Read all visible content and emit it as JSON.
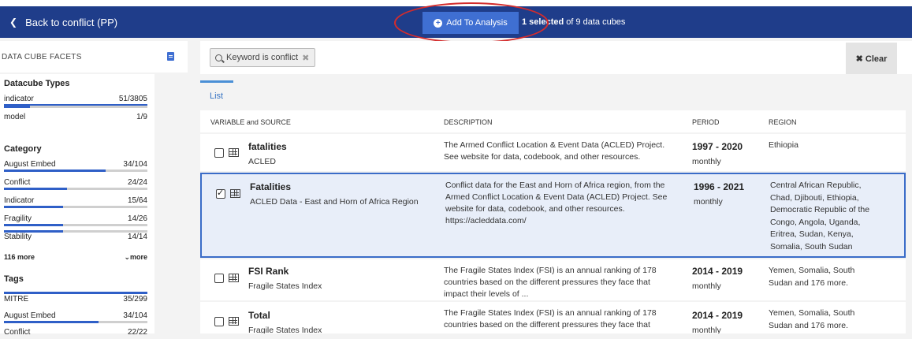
{
  "header": {
    "back_label": "Back to conflict (PP)",
    "add_button_label": "Add To Analysis",
    "selected_count": "1 selected",
    "selected_suffix": "of 9 data cubes"
  },
  "sidebar": {
    "title": "DATA CUBE FACETS",
    "groups": [
      {
        "title": "Datacube Types",
        "items": [
          {
            "label": "indicator",
            "count": "51/3805",
            "fraction": 1.0
          },
          {
            "label": "model",
            "count": "1/9",
            "fraction": 0.18
          }
        ]
      },
      {
        "title": "Category",
        "items": [
          {
            "label": "August Embed",
            "count": "34/104",
            "fraction": 0.71
          },
          {
            "label": "Conflict",
            "count": "24/24",
            "fraction": 0.44
          },
          {
            "label": "Indicator",
            "count": "15/64",
            "fraction": 0.41
          },
          {
            "label": "Fragility",
            "count": "14/26",
            "fraction": 0.41
          },
          {
            "label": "Stability",
            "count": "14/14",
            "fraction": 0.41
          }
        ],
        "more_left": "116 more",
        "more_right": "more"
      },
      {
        "title": "Tags",
        "items": [
          {
            "label": "MITRE",
            "count": "35/299",
            "fraction": 1.0
          },
          {
            "label": "August Embed",
            "count": "34/104",
            "fraction": 0.66
          },
          {
            "label": "Conflict",
            "count": "22/22",
            "fraction": 0.4
          }
        ]
      }
    ]
  },
  "search": {
    "chip_text": "Keyword  is  conflict",
    "clear_label": "Clear"
  },
  "tabs": {
    "list_label": "List"
  },
  "table": {
    "headers": {
      "variable": "VARIABLE and SOURCE",
      "description": "DESCRIPTION",
      "period": "PERIOD",
      "region": "REGION"
    },
    "rows": [
      {
        "name": "fatalities",
        "source": "ACLED",
        "description": "The Armed Conflict Location & Event Data (ACLED) Project. See website for data, codebook, and other resources.",
        "period": "1997 - 2020",
        "frequency": "monthly",
        "region": "Ethiopia",
        "selected": false
      },
      {
        "name": "Fatalities",
        "source": "ACLED Data - East and Horn of Africa Region",
        "description": "Conflict data for the East and Horn of Africa region, from the Armed Conflict Location & Event Data (ACLED) Project. See website for data, codebook, and other resources. https://acleddata.com/",
        "period": "1996 - 2021",
        "frequency": "monthly",
        "region": "Central African Republic, Chad, Djibouti, Ethiopia, Democratic Republic of the Congo, Angola, Uganda, Eritrea, Sudan, Kenya, Somalia, South Sudan",
        "selected": true
      },
      {
        "name": "FSI Rank",
        "source": "Fragile States Index",
        "description": "The Fragile States Index (FSI) is an annual ranking of 178 countries based on the different pressures they face that impact their levels of ...",
        "period": "2014 - 2019",
        "frequency": "monthly",
        "region": "Yemen, Somalia, South Sudan and 176 more.",
        "selected": false
      },
      {
        "name": "Total",
        "source": "Fragile States Index",
        "description": "The Fragile States Index (FSI) is an annual ranking of 178 countries based on the different pressures they face that",
        "period": "2014 - 2019",
        "frequency": "monthly",
        "region": "Yemen, Somalia, South Sudan and 176 more.",
        "selected": false
      }
    ]
  },
  "colors": {
    "header_bg": "#1f3d8a",
    "accent": "#3f6fd2",
    "annotation": "#d42c2c",
    "selected_row_bg": "#e8eef9"
  }
}
